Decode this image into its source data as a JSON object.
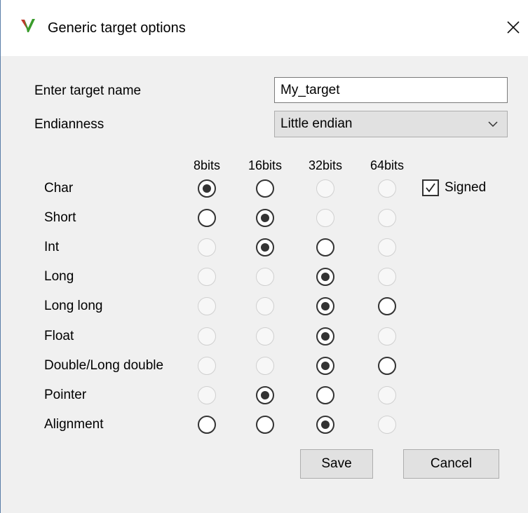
{
  "window": {
    "title": "Generic target options",
    "icon": "v-logo-icon",
    "close": "close-icon"
  },
  "form": {
    "name_label": "Enter target name",
    "name_value": "My_target",
    "endianness_label": "Endianness",
    "endianness_value": "Little endian"
  },
  "columns": [
    "8bits",
    "16bits",
    "32bits",
    "64bits"
  ],
  "rows": [
    {
      "label": "Char",
      "states": [
        "checked",
        "enabled",
        "disabled",
        "disabled"
      ]
    },
    {
      "label": "Short",
      "states": [
        "enabled",
        "checked",
        "disabled",
        "disabled"
      ]
    },
    {
      "label": "Int",
      "states": [
        "disabled",
        "checked",
        "enabled",
        "disabled"
      ]
    },
    {
      "label": "Long",
      "states": [
        "disabled",
        "disabled",
        "checked",
        "disabled"
      ]
    },
    {
      "label": "Long long",
      "states": [
        "disabled",
        "disabled",
        "checked",
        "enabled"
      ]
    },
    {
      "label": "Float",
      "states": [
        "disabled",
        "disabled",
        "checked",
        "disabled"
      ]
    },
    {
      "label": "Double/Long double",
      "states": [
        "disabled",
        "disabled",
        "checked",
        "enabled"
      ]
    },
    {
      "label": "Pointer",
      "states": [
        "disabled",
        "checked",
        "enabled",
        "disabled"
      ]
    },
    {
      "label": "Alignment",
      "states": [
        "enabled",
        "enabled",
        "checked",
        "disabled"
      ]
    }
  ],
  "signed": {
    "label": "Signed",
    "checked": true
  },
  "buttons": {
    "save": "Save",
    "cancel": "Cancel"
  },
  "colors": {
    "logo_green": "#3a9c2c",
    "logo_red": "#c0392b",
    "frame_border": "#5a7ea8"
  }
}
